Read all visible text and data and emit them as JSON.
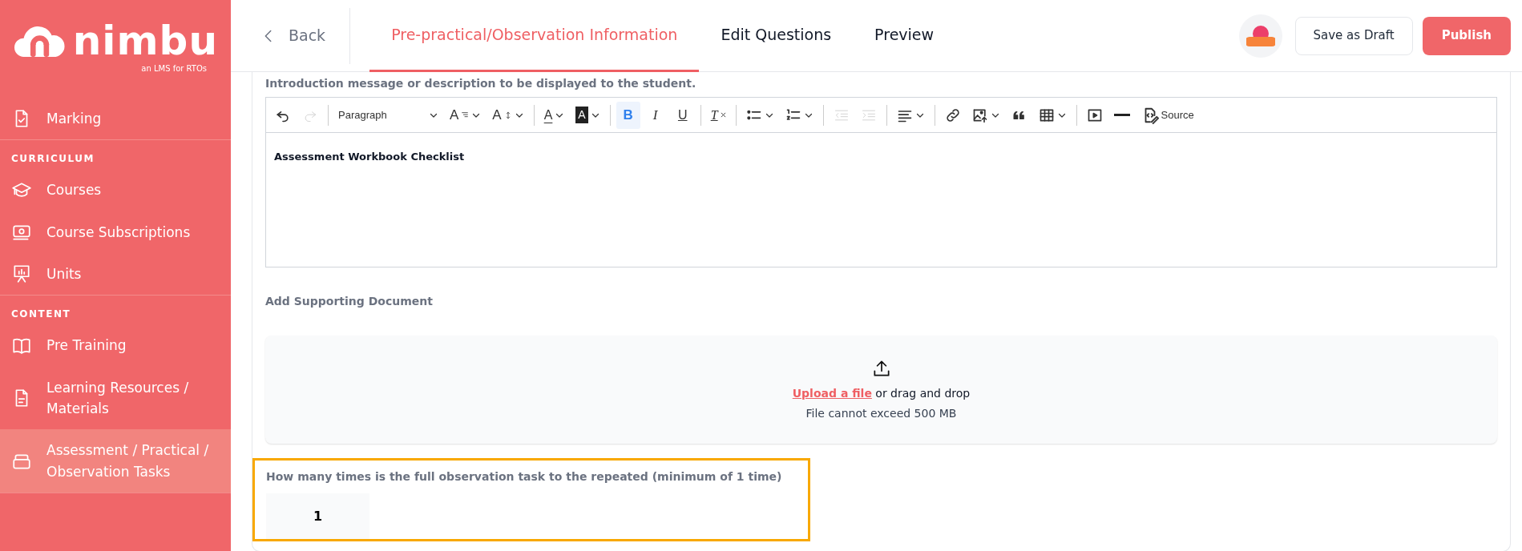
{
  "sidebar": {
    "logo": {
      "name": "nimbu",
      "tagline": "an LMS for RTOs"
    },
    "sections": [
      {
        "items": [
          {
            "label": "Marking",
            "kind": "check-doc",
            "selected": false
          }
        ]
      },
      {
        "title": "CURRICULUM",
        "items": [
          {
            "label": "Courses",
            "kind": "cap",
            "selected": false
          },
          {
            "label": "Course Subscriptions",
            "kind": "money",
            "selected": false
          },
          {
            "label": "Units",
            "kind": "board",
            "selected": false
          }
        ]
      },
      {
        "title": "CONTENT",
        "items": [
          {
            "label": "Pre Training",
            "kind": "book",
            "selected": false
          },
          {
            "label": "Learning Resources / Materials",
            "kind": "doc",
            "selected": false
          },
          {
            "label": "Assessment / Practical / Observation Tasks",
            "kind": "stack",
            "selected": true
          }
        ]
      }
    ]
  },
  "header": {
    "back": "Back",
    "tabs": [
      {
        "label": "Pre-practical/Observation Information",
        "selected": true
      },
      {
        "label": "Edit Questions",
        "selected": false
      },
      {
        "label": "Preview",
        "selected": false
      }
    ],
    "save": "Save as Draft",
    "publish": "Publish"
  },
  "form": {
    "intro_label": "Introduction message or description to be displayed to the student.",
    "toolbar": [
      {
        "kind": "undo",
        "disabled": false
      },
      {
        "kind": "redo",
        "disabled": true
      },
      {
        "kind": "sep"
      },
      {
        "kind": "heading",
        "label": "Paragraph"
      },
      {
        "kind": "size",
        "label": "A"
      },
      {
        "kind": "lineheight",
        "label": "A"
      },
      {
        "kind": "sep"
      },
      {
        "kind": "color",
        "label": "A"
      },
      {
        "kind": "highlight",
        "label": "A"
      },
      {
        "kind": "sep"
      },
      {
        "kind": "bold",
        "label": "B",
        "active": true
      },
      {
        "kind": "italic",
        "label": "I",
        "active": false
      },
      {
        "kind": "underline",
        "label": "U",
        "active": false
      },
      {
        "kind": "sep"
      },
      {
        "kind": "clear",
        "label": "T"
      },
      {
        "kind": "sep"
      },
      {
        "kind": "bullets"
      },
      {
        "kind": "numbers"
      },
      {
        "kind": "sep"
      },
      {
        "kind": "outdent",
        "disabled": true
      },
      {
        "kind": "indent",
        "disabled": true
      },
      {
        "kind": "sep"
      },
      {
        "kind": "align"
      },
      {
        "kind": "sep"
      },
      {
        "kind": "link"
      },
      {
        "kind": "image"
      },
      {
        "kind": "quote"
      },
      {
        "kind": "table"
      },
      {
        "kind": "sep"
      },
      {
        "kind": "media"
      },
      {
        "kind": "hr"
      },
      {
        "kind": "source",
        "label": "Source"
      }
    ],
    "editor_text": "Assessment Workbook Checklist",
    "doc_label": "Add Supporting Document",
    "upload": {
      "link": "Upload a file",
      "rest": "or drag and drop",
      "hint": "File cannot exceed 500 MB"
    },
    "repeat": {
      "label": "How many times is the full observation task to the repeated (minimum of 1 time)",
      "value": "1",
      "highlighted": true
    }
  }
}
